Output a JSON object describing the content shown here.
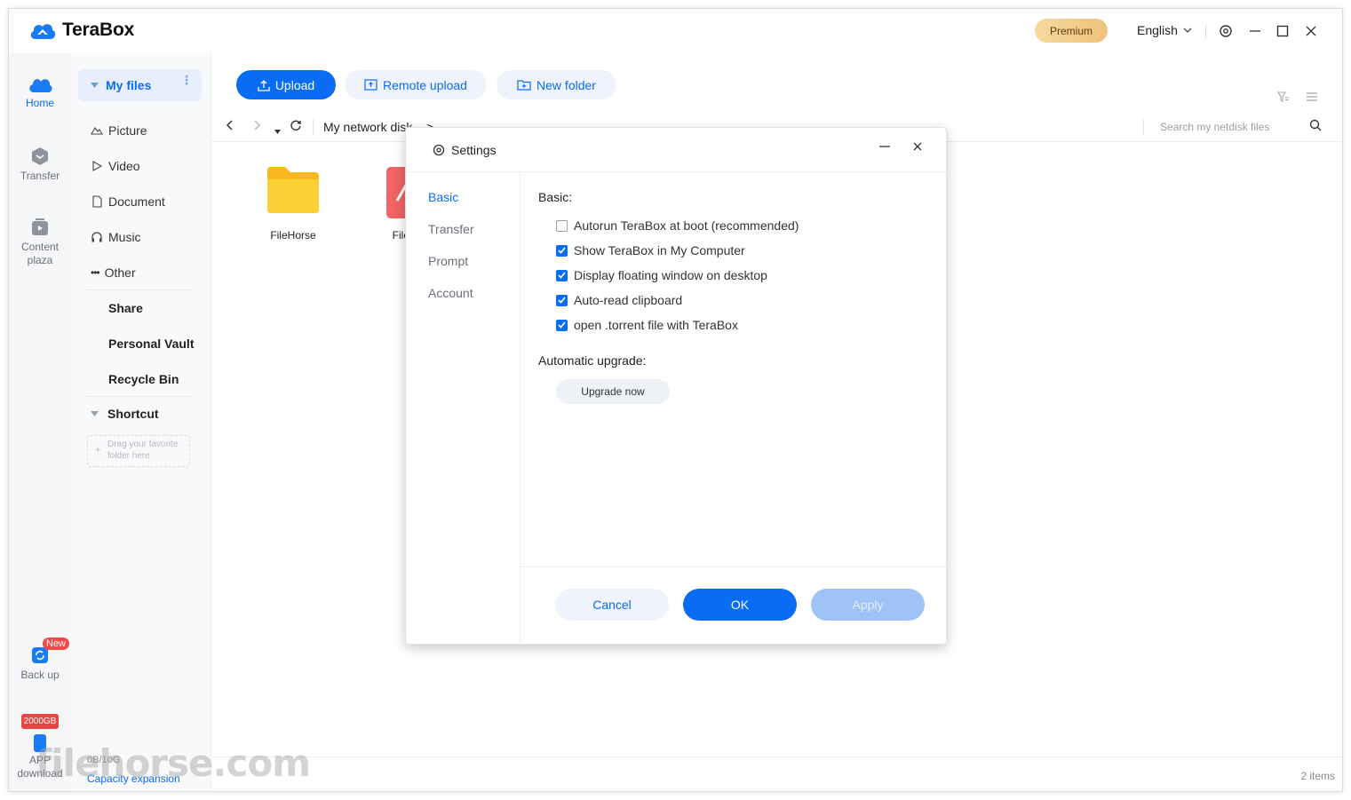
{
  "app": {
    "title": "TeraBox",
    "premium_label": "Premium",
    "language": "English"
  },
  "rail": {
    "home": "Home",
    "transfer": "Transfer",
    "content_plaza_1": "Content",
    "content_plaza_2": "plaza",
    "backup": "Back up",
    "backup_badge": "New",
    "app_gb_badge": "2000GB",
    "app_download_1": "APP",
    "app_download_2": "download"
  },
  "sidebar": {
    "my_files": "My files",
    "items": [
      {
        "label": "Picture"
      },
      {
        "label": "Video"
      },
      {
        "label": "Document"
      },
      {
        "label": "Music"
      },
      {
        "label": "Other"
      }
    ],
    "share": "Share",
    "personal_vault": "Personal Vault",
    "recycle_bin": "Recycle Bin",
    "shortcut": "Shortcut",
    "dropzone_1": "Drag your favorite",
    "dropzone_2": "folder here",
    "storage": "0B/10G",
    "capacity_expansion": "Capacity expansion"
  },
  "toolbar": {
    "upload": "Upload",
    "remote_upload": "Remote upload",
    "new_folder": "New folder"
  },
  "breadcrumb": {
    "root": "My network disk",
    "sep": ">"
  },
  "search": {
    "placeholder": "Search my netdisk files"
  },
  "files": [
    {
      "name": "FileHorse",
      "type": "folder"
    },
    {
      "name": "Fileho",
      "type": "pdf"
    }
  ],
  "status": {
    "items_count": "2 items"
  },
  "settings": {
    "title": "Settings",
    "tabs": [
      {
        "label": "Basic",
        "active": true
      },
      {
        "label": "Transfer",
        "active": false
      },
      {
        "label": "Prompt",
        "active": false
      },
      {
        "label": "Account",
        "active": false
      }
    ],
    "basic_title": "Basic:",
    "options": [
      {
        "label": "Autorun TeraBox at boot (recommended)",
        "checked": false
      },
      {
        "label": "Show TeraBox in My Computer",
        "checked": true
      },
      {
        "label": "Display floating window on desktop",
        "checked": true
      },
      {
        "label": "Auto-read clipboard",
        "checked": true
      },
      {
        "label": "open .torrent file with TeraBox",
        "checked": true
      }
    ],
    "upgrade_title": "Automatic upgrade:",
    "upgrade_button": "Upgrade now",
    "cancel": "Cancel",
    "ok": "OK",
    "apply": "Apply"
  },
  "watermark": "filehorse.com",
  "colors": {
    "accent": "#0a6cf5",
    "apply_disabled": "#9fc3f6",
    "badge_red": "#f04a4a"
  }
}
